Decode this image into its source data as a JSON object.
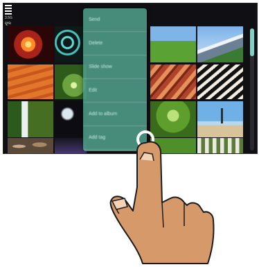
{
  "status": {
    "line1": "3.5G",
    "line2": "ଫୁଲ"
  },
  "menu": {
    "items": [
      {
        "label": "Send"
      },
      {
        "label": "Delete"
      },
      {
        "label": "Slide show"
      },
      {
        "label": "Edit"
      },
      {
        "label": "Add to album"
      },
      {
        "label": "Add tag"
      }
    ]
  },
  "colors": {
    "menu": "#50a08c",
    "accent": "#7fd1c8",
    "screen": "#101014"
  }
}
